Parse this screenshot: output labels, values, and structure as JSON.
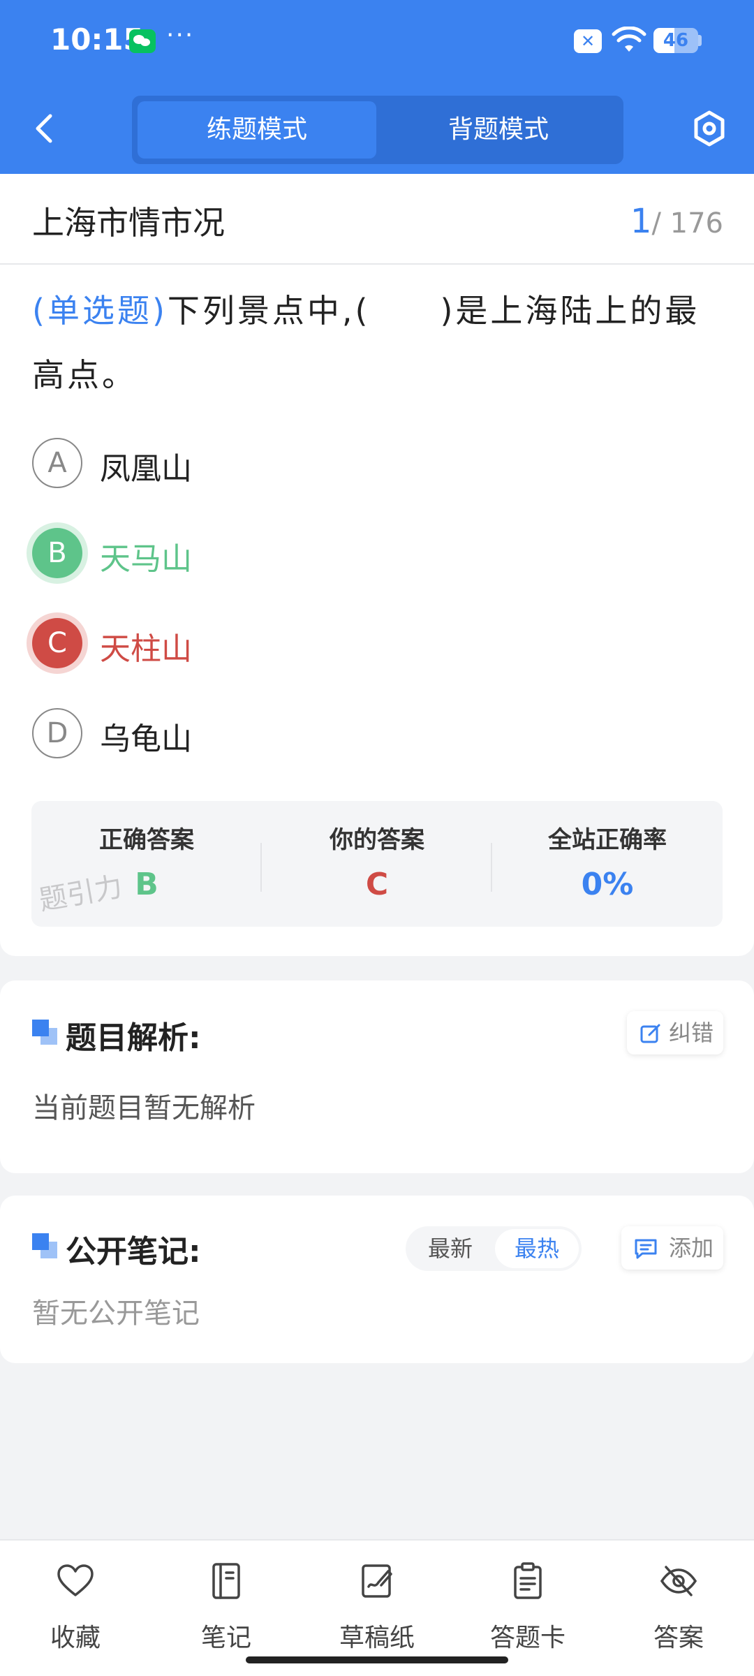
{
  "status_bar": {
    "time": "10:15",
    "more": "···",
    "battery": "46"
  },
  "header": {
    "modes": [
      "练题模式",
      "背题模式"
    ],
    "active_mode": "练题模式"
  },
  "section": {
    "title": "上海市情市况",
    "current": "1",
    "total": "/ 176"
  },
  "question": {
    "type": "(单选题)",
    "text": "下列景点中,(　　)是上海陆上的最高点。",
    "options": [
      {
        "letter": "A",
        "text": "凤凰山",
        "state": "normal"
      },
      {
        "letter": "B",
        "text": "天马山",
        "state": "correct"
      },
      {
        "letter": "C",
        "text": "天柱山",
        "state": "wrong"
      },
      {
        "letter": "D",
        "text": "乌龟山",
        "state": "normal"
      }
    ]
  },
  "result": {
    "correct_label": "正确答案",
    "correct_value": "B",
    "yours_label": "你的答案",
    "yours_value": "C",
    "rate_label": "全站正确率",
    "rate_value": "0%",
    "watermark": "题引力",
    "colors": {
      "correct": "#5ec48a",
      "wrong": "#cf4b45",
      "accent": "#3b82f0"
    }
  },
  "analysis": {
    "title": "题目解析:",
    "correction_button": "纠错",
    "body": "当前题目暂无解析"
  },
  "notes": {
    "title": "公开笔记:",
    "sort_options": [
      "最新",
      "最热"
    ],
    "active_sort": "最热",
    "add_button": "添加",
    "empty": "暂无公开笔记"
  },
  "bottom_nav": [
    {
      "label": "收藏",
      "icon": "heart-icon"
    },
    {
      "label": "笔记",
      "icon": "notebook-icon"
    },
    {
      "label": "草稿纸",
      "icon": "draft-paper-icon"
    },
    {
      "label": "答题卡",
      "icon": "answer-sheet-icon"
    },
    {
      "label": "答案",
      "icon": "eye-off-icon"
    }
  ]
}
